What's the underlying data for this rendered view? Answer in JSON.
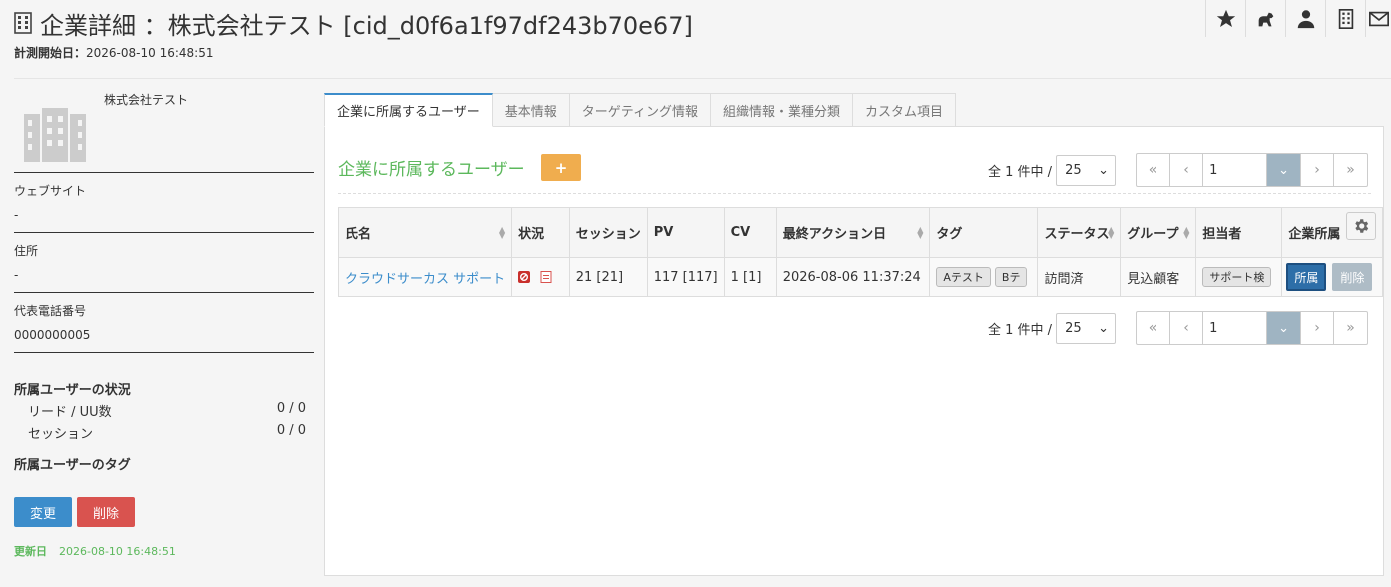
{
  "header": {
    "title": "企業詳細 ：株式会社テスト [cid_d0f6a1f97df243b70e67]",
    "measure_label": "計測開始日：",
    "measure_value": "2026-08-10 16:48:51"
  },
  "top_icons": [
    "star-icon",
    "dog-icon",
    "user-icon",
    "building-icon",
    "mail-icon"
  ],
  "sidebar": {
    "company_name": "株式会社テスト",
    "fields": [
      {
        "label": "ウェブサイト",
        "value": "-"
      },
      {
        "label": "住所",
        "value": "-"
      },
      {
        "label": "代表電話番号",
        "value": "0000000005"
      }
    ],
    "status_title": "所属ユーザーの状況",
    "status_rows": [
      {
        "label": "リード / UU数",
        "value": "0 / 0"
      },
      {
        "label": "セッション",
        "value": "0 / 0"
      }
    ],
    "tags_title": "所属ユーザーのタグ",
    "change_label": "変更",
    "delete_label": "削除",
    "updated_label": "更新日",
    "updated_value": "2026-08-10 16:48:51"
  },
  "tabs": [
    {
      "label": "企業に所属するユーザー",
      "active": true
    },
    {
      "label": "基本情報"
    },
    {
      "label": "ターゲティング情報"
    },
    {
      "label": "組織情報・業種分類"
    },
    {
      "label": "カスタム項目"
    }
  ],
  "section": {
    "title": "企業に所属するユーザー",
    "add_label": "+"
  },
  "pagination": {
    "count_label": "全 1 件中 /",
    "per_page": "25",
    "first": "«",
    "prev": "‹",
    "page": "1",
    "next": "›",
    "last": "»"
  },
  "table": {
    "headers": [
      "氏名",
      "状況",
      "セッション",
      "PV",
      "CV",
      "最終アクション日",
      "タグ",
      "ステータス",
      "グループ",
      "担当者",
      "企業所属"
    ],
    "rows": [
      {
        "name": "クラウドサーカス サポート",
        "session": "21 [21]",
        "pv": "117 [117]",
        "cv": "1 [1]",
        "last_action": "2026-08-06 11:37:24",
        "tags": [
          "Aテスト",
          "Bテ"
        ],
        "status": "訪問済",
        "group": "見込顧客",
        "owner": "サポート検",
        "affil_label": "所属",
        "remove_label": "削除"
      }
    ]
  },
  "colors": {
    "accent": "#3c8dcb",
    "danger": "#d9534f",
    "warning": "#f0ad4e",
    "success": "#5cb85c"
  }
}
